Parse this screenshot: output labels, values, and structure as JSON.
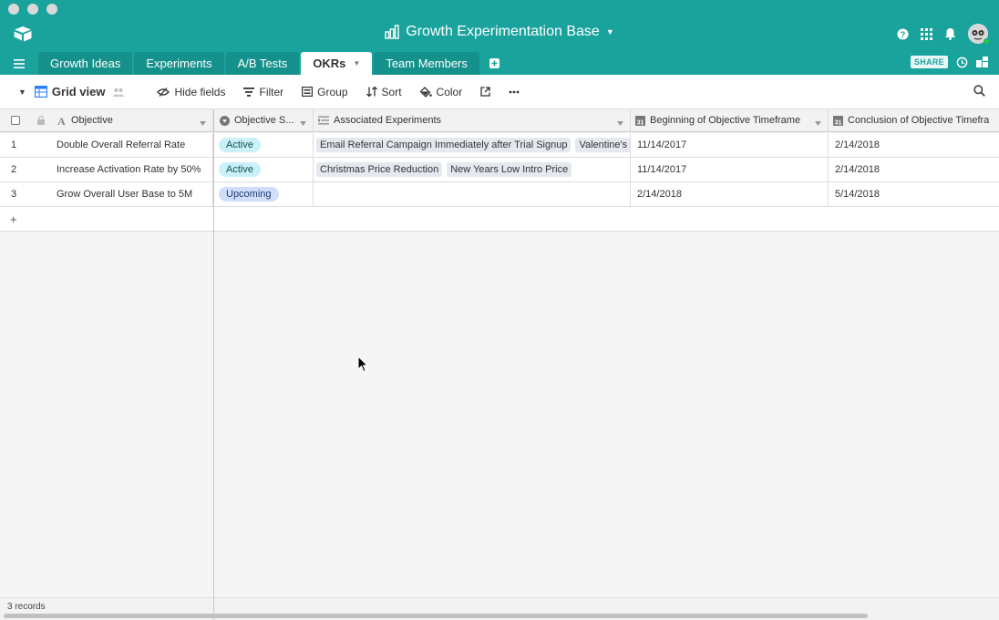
{
  "app": {
    "base_title": "Growth Experimentation Base",
    "colors": {
      "header": "#1aa39d",
      "active_pill": "#c9f1f7",
      "upcoming_pill": "#cfdffb"
    }
  },
  "tabs": [
    {
      "label": "Growth Ideas"
    },
    {
      "label": "Experiments"
    },
    {
      "label": "A/B Tests"
    },
    {
      "label": "OKRs",
      "active": true
    },
    {
      "label": "Team Members"
    }
  ],
  "share_label": "SHARE",
  "toolbar": {
    "view_name": "Grid view",
    "hide_fields": "Hide fields",
    "filter": "Filter",
    "group": "Group",
    "sort": "Sort",
    "color": "Color"
  },
  "columns": [
    {
      "name": "Objective",
      "icon": "text-icon"
    },
    {
      "name": "Objective S...",
      "icon": "single-select-icon"
    },
    {
      "name": "Associated Experiments",
      "icon": "link-icon"
    },
    {
      "name": "Beginning of Objective Timeframe",
      "icon": "calendar-icon"
    },
    {
      "name": "Conclusion of Objective Timefra",
      "icon": "calendar-icon"
    }
  ],
  "rows": [
    {
      "num": "1",
      "objective": "Double Overall Referral Rate",
      "status": "Active",
      "experiments": [
        "Email Referral Campaign Immediately after Trial Signup",
        "Valentine's"
      ],
      "begin": "11/14/2017",
      "end": "2/14/2018"
    },
    {
      "num": "2",
      "objective": "Increase Activation Rate by 50%",
      "status": "Active",
      "experiments": [
        "Christmas Price Reduction",
        "New Years Low Intro Price"
      ],
      "begin": "11/14/2017",
      "end": "2/14/2018"
    },
    {
      "num": "3",
      "objective": "Grow Overall User Base to 5M",
      "status": "Upcoming",
      "experiments": [],
      "begin": "2/14/2018",
      "end": "5/14/2018"
    }
  ],
  "add_row_label": "+",
  "footer": {
    "record_count": "3 records"
  }
}
